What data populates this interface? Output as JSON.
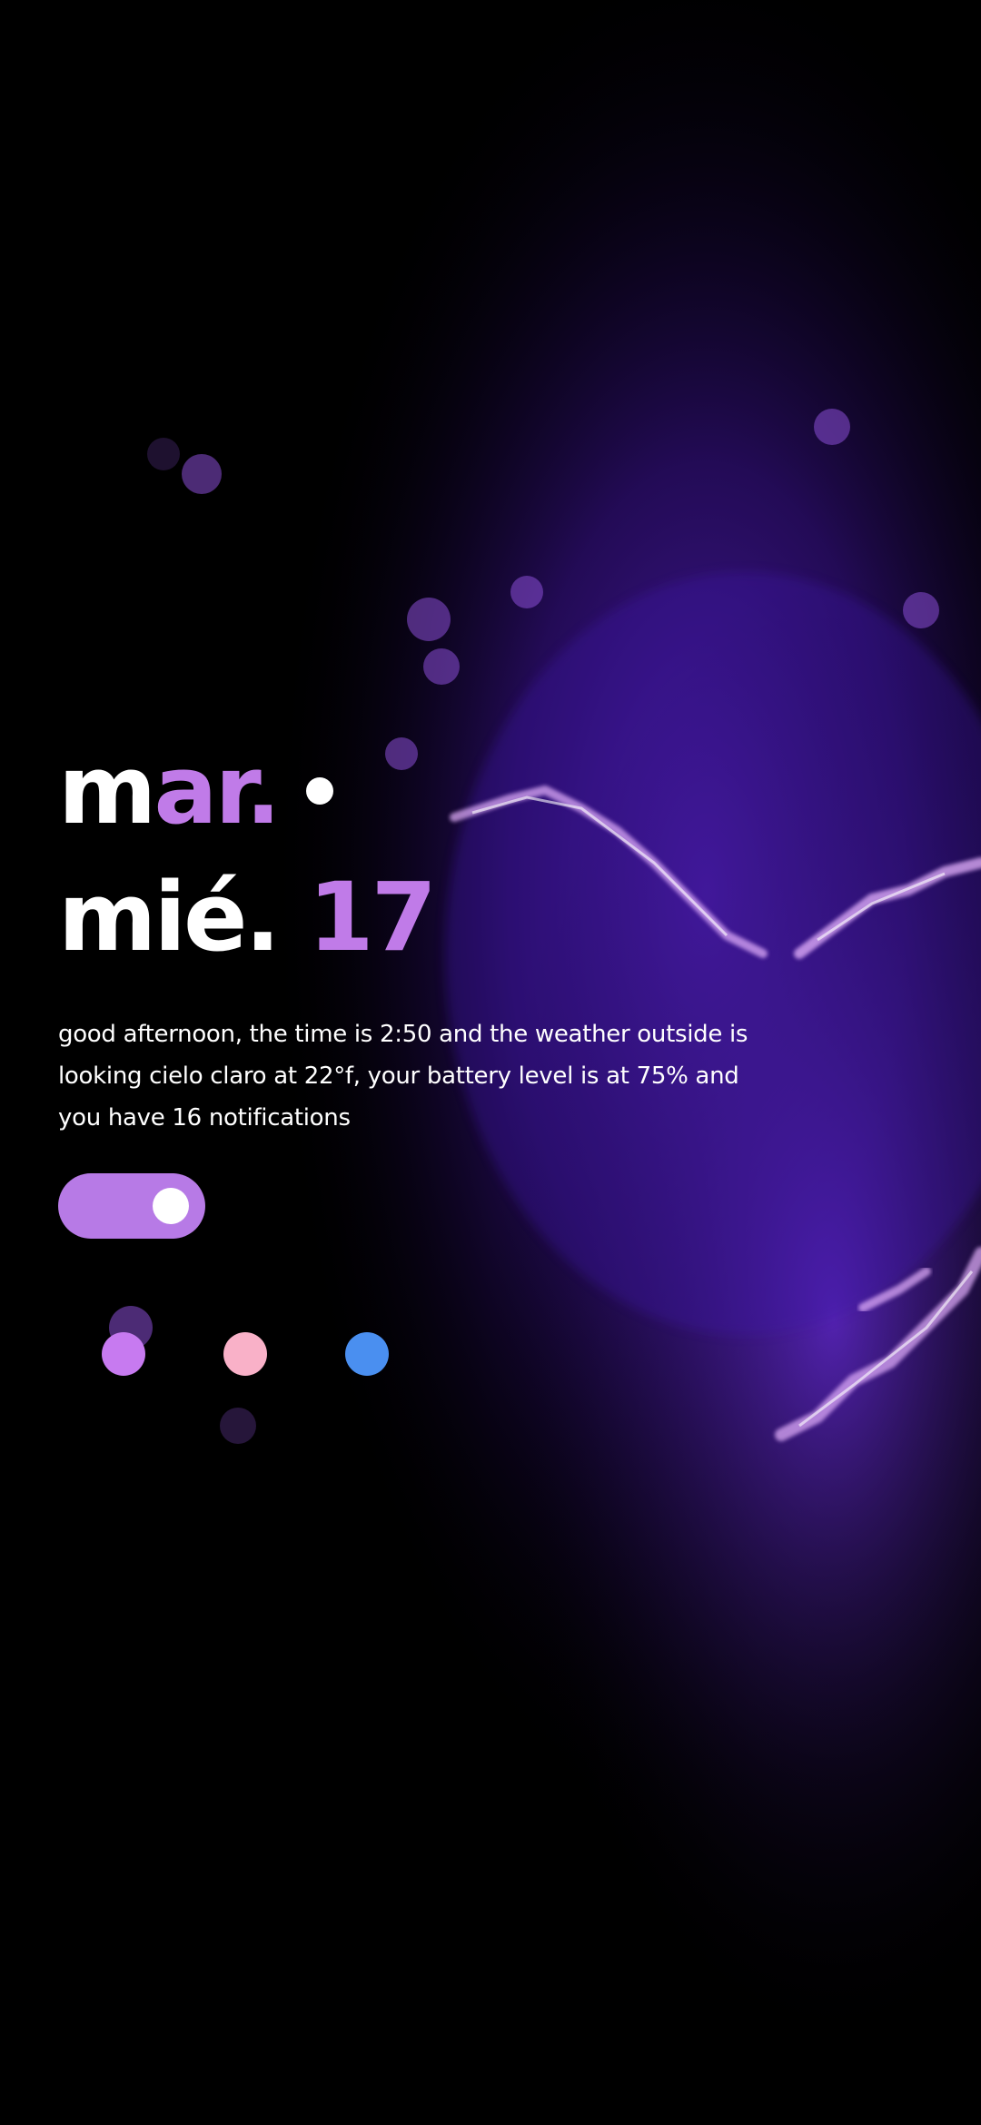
{
  "clock": {
    "month_prefix": "m",
    "month_suffix": "ar.",
    "day_name": "mié.",
    "day_number": "17"
  },
  "message": "good afternoon, the time is 2:50 and the weather outside is looking cielo claro at 22°f, your battery level is at 75% and you have 16 notifications",
  "toggle": {
    "state": "on",
    "color": "#b77ae6"
  },
  "swatches": [
    {
      "name": "purple",
      "color": "#c77af0"
    },
    {
      "name": "pink",
      "color": "#f9b1c8"
    },
    {
      "name": "blue",
      "color": "#4a8ff0"
    }
  ],
  "theme": {
    "accent": "#c07be8",
    "background": "#000000",
    "wallpaper": "purple lightning nebula"
  }
}
